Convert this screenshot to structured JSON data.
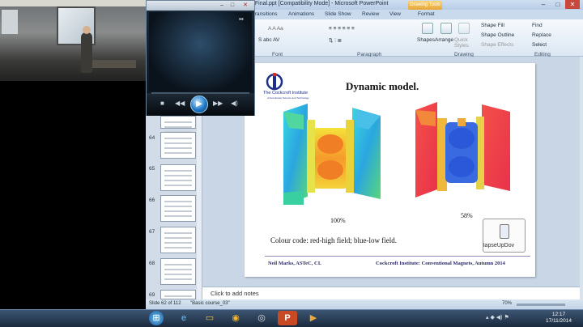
{
  "window": {
    "title": "_Final.ppt [Compatibility Mode] - Microsoft PowerPoint",
    "contextual_tab": "Drawing Tools"
  },
  "tabs": [
    "Transitions",
    "Animations",
    "Slide Show",
    "Review",
    "View",
    "Format"
  ],
  "ribbon": {
    "groups": [
      "Font",
      "Paragraph",
      "Drawing",
      "Editing"
    ],
    "buttons": {
      "shapes": "Shapes",
      "arrange": "Arrange",
      "quick_styles": "Quick Styles",
      "shape_fill": "Shape Fill",
      "shape_outline": "Shape Outline",
      "shape_effects": "Shape Effects",
      "find": "Find",
      "replace": "Replace",
      "select": "Select"
    }
  },
  "thumbnails": [
    "64",
    "65",
    "66",
    "67",
    "68",
    "69"
  ],
  "slide": {
    "title": "Dynamic  model.",
    "logo_text": "The Cockcroft Institute",
    "logo_sub": "of Accelerator Science and Technology",
    "left_pct": "100%",
    "right_pct": "58%",
    "colour_code": "Colour code: red-high  field;     blue-low  field.",
    "footer_left": "Neil Marks, ASTeC, CI.",
    "footer_right": "Cockcroft Institute:  Conventional  Magnets,  Autumn  2014",
    "popup_label": "lapseUpDov"
  },
  "notes_placeholder": "Click to add notes",
  "status": {
    "slide_info": "Slide 62 of 112",
    "theme": "\"Basic course_03\"",
    "zoom": "70%"
  },
  "clock": {
    "time": "12:17",
    "date": "17/11/2014"
  },
  "colors": {
    "accent": "#e7a53a",
    "ribbon": "#dce7f3"
  }
}
